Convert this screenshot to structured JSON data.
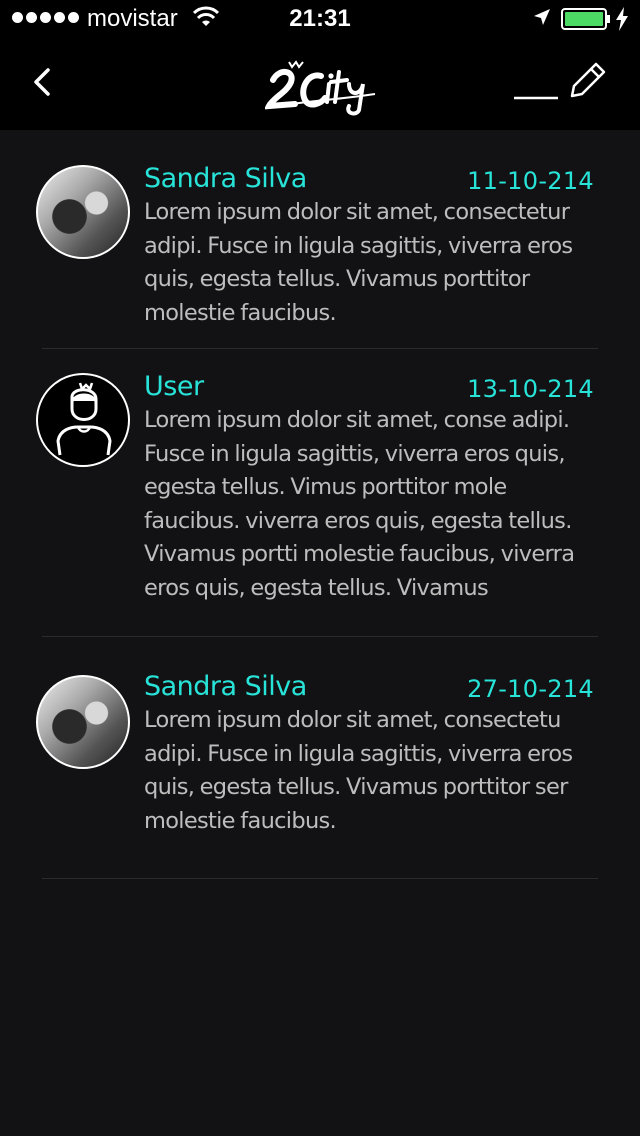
{
  "status_bar": {
    "carrier": "movistar",
    "time": "21:31"
  },
  "nav": {
    "logo_text": "2City"
  },
  "messages": [
    {
      "name": "Sandra Silva",
      "date": "11-10-214",
      "text": "Lorem ipsum dolor sit amet, consectetur adipi. Fusce in ligula sagittis, viverra eros quis, egesta tellus. Vivamus porttitor molestie faucibus.",
      "avatar": "photo"
    },
    {
      "name": "User",
      "date": "13-10-214",
      "text": "Lorem ipsum dolor sit amet, conse adipi. Fusce in ligula sagittis, viverra eros quis, egesta tellus. Vimus porttitor mole faucibus. viverra eros quis, egesta tellus. Vivamus portti molestie faucibus, viverra eros quis, egesta tellus. Vivamus",
      "avatar": "user-icon"
    },
    {
      "name": "Sandra Silva",
      "date": "27-10-214",
      "text": "Lorem ipsum dolor sit amet, consectetu adipi. Fusce in ligula sagittis, viverra eros quis, egesta tellus. Vivamus porttitor ser molestie faucibus.",
      "avatar": "photo"
    }
  ],
  "colors": {
    "accent": "#28e3d8",
    "background": "#121214",
    "bar": "#000000",
    "body_text": "#bdbdbd",
    "battery": "#4cd964"
  }
}
